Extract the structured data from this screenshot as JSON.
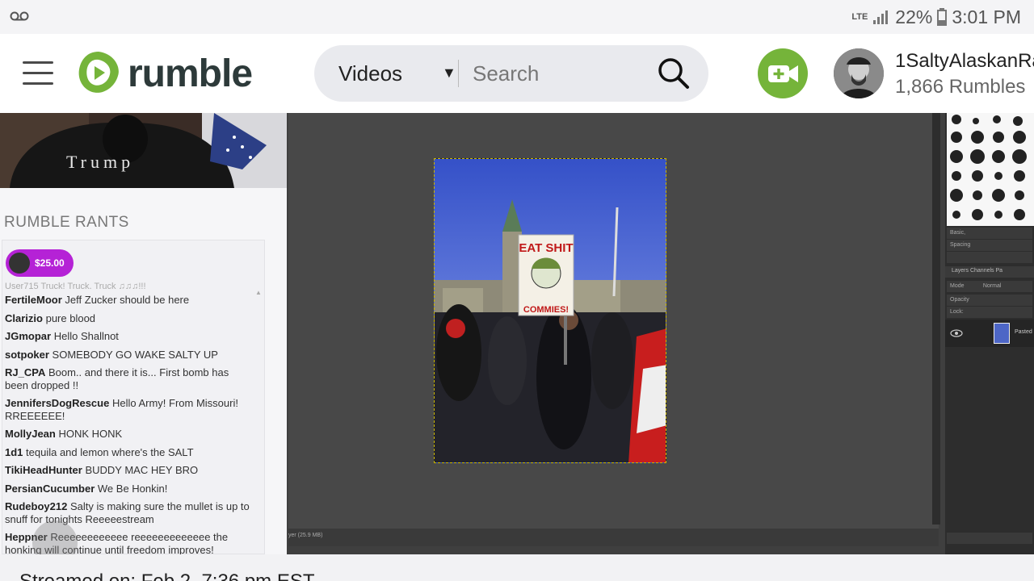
{
  "status_bar": {
    "network": "LTE",
    "battery": "22%",
    "time": "3:01 PM"
  },
  "header": {
    "logo_text": "rumble",
    "search": {
      "category": "Videos",
      "placeholder": "Search"
    },
    "user": {
      "name": "1SaltyAlaskanRa",
      "rumbles": "1,866 Rumbles"
    }
  },
  "webcam": {
    "shirt_text": "Trump"
  },
  "rants": {
    "title": "RUMBLE RANTS",
    "badge_amount": "$25.00",
    "messages": [
      {
        "user": "User715",
        "text": "Truck! Truck, Truck ♫♫♫!!!"
      },
      {
        "user": "FertileMoor",
        "text": "Jeff Zucker should be here"
      },
      {
        "user": "Clarizio",
        "text": "pure blood"
      },
      {
        "user": "JGmopar",
        "text": "Hello Shallnot"
      },
      {
        "user": "sotpoker",
        "text": "SOMEBODY GO WAKE SALTY UP"
      },
      {
        "user": "RJ_CPA",
        "text": "Boom.. and there it is... First bomb has been dropped !!"
      },
      {
        "user": "JennifersDogRescue",
        "text": "Hello Army! From Missouri! RREEEEEE!"
      },
      {
        "user": "MollyJean",
        "text": "HONK HONK"
      },
      {
        "user": "1d1",
        "text": "tequila and lemon where's the SALT"
      },
      {
        "user": "TikiHeadHunter",
        "text": "BUDDY MAC HEY BRO"
      },
      {
        "user": "PersianCucumber",
        "text": "We Be Honkin!"
      },
      {
        "user": "Rudeboy212",
        "text": "Salty is making sure the mullet is up to snuff for tonights Reeeeestream"
      },
      {
        "user": "Heppner",
        "text": "Reeeeeeeeeeee reeeeeeeeeeeee the honking will continue until freedom improves!"
      }
    ]
  },
  "gimp": {
    "sign_top": "EAT SHIT",
    "sign_bottom": "COMMIES!",
    "status_text": "yer (25.9 MB)",
    "dock": {
      "brush_name": "Basic,",
      "spacing_label": "Spacing",
      "tabs": "Layers  Channels  Pa",
      "mode_label": "Mode",
      "mode_value": "Normal",
      "opacity_label": "Opacity",
      "lock_label": "Lock:",
      "layer_name": "Pasted"
    }
  },
  "footer": {
    "streamed": "Streamed on: Feb 2, 7:36 pm EST"
  },
  "colors": {
    "brand_green": "#75b43a",
    "rant_purple": "#b522d6"
  }
}
